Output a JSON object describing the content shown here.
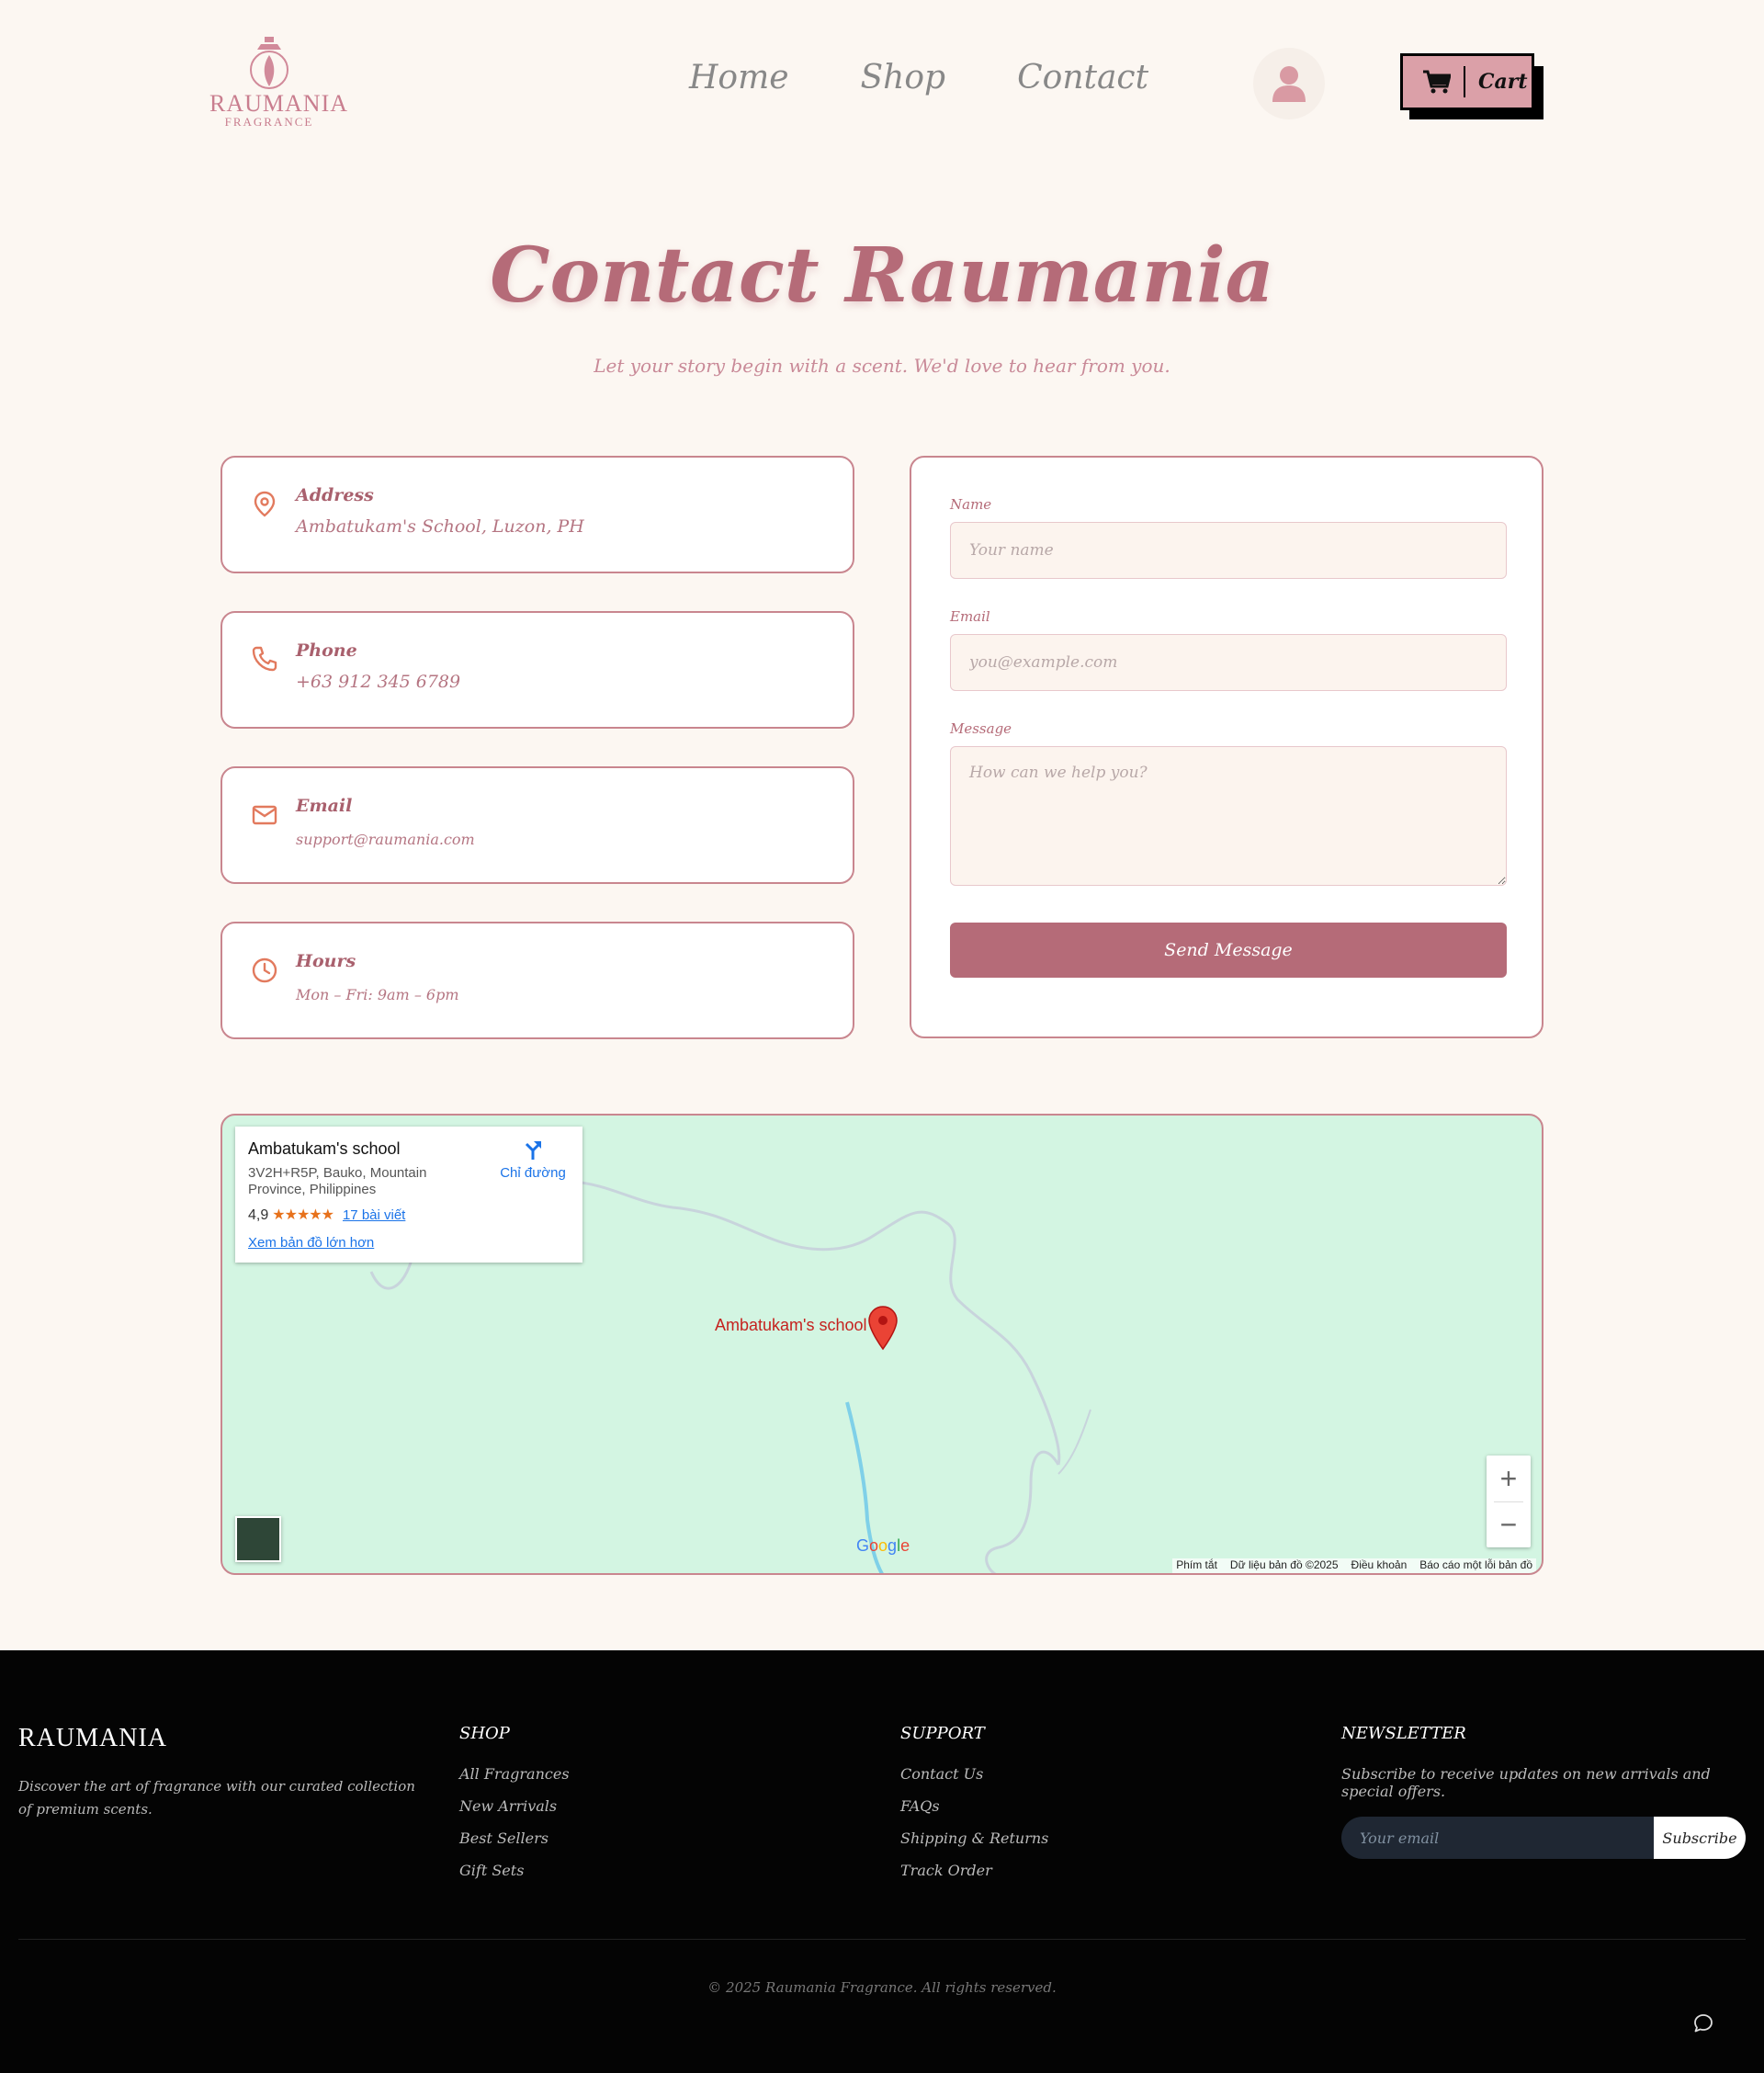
{
  "header": {
    "logo": {
      "brand": "RAUMANIA",
      "sub": "FRAGRANCE"
    },
    "nav": [
      {
        "label": "Home"
      },
      {
        "label": "Shop"
      },
      {
        "label": "Contact"
      }
    ],
    "cart_label": "Cart",
    "user_icon": "user-icon",
    "cart_icon": "cart-icon"
  },
  "hero": {
    "title": "Contact Raumania",
    "subtitle": "Let your story begin with a scent. We'd love to hear from you."
  },
  "info": [
    {
      "title": "Address",
      "value": "Ambatukam's School, Luzon, PH",
      "icon": "map-pin-icon"
    },
    {
      "title": "Phone",
      "value": "+63 912 345 6789",
      "icon": "phone-icon"
    },
    {
      "title": "Email",
      "value": "support@raumania.com",
      "icon": "mail-icon"
    },
    {
      "title": "Hours",
      "value": "Mon – Fri: 9am – 6pm",
      "icon": "clock-icon"
    }
  ],
  "form": {
    "name_label": "Name",
    "name_placeholder": "Your name",
    "email_label": "Email",
    "email_placeholder": "you@example.com",
    "message_label": "Message",
    "message_placeholder": "How can we help you?",
    "submit_label": "Send Message"
  },
  "map": {
    "place_name": "Ambatukam's school",
    "address": "3V2H+R5P, Bauko, Mountain Province, Philippines",
    "rating": "4,9",
    "stars": "★★★★★",
    "reviews": "17 bài viết",
    "directions": "Chỉ đường",
    "view_larger": "Xem bản đồ lớn hơn",
    "marker_label": "Ambatukam's school",
    "zoom_in": "+",
    "zoom_out": "−",
    "attribution": [
      "Phím tắt",
      "Dữ liệu bản đồ ©2025",
      "Điều khoản",
      "Báo cáo một lỗi bản đồ"
    ]
  },
  "footer": {
    "brand": "RAUMANIA",
    "description": "Discover the art of fragrance with our curated collection of premium scents.",
    "shop": {
      "heading": "SHOP",
      "links": [
        "All Fragrances",
        "New Arrivals",
        "Best Sellers",
        "Gift Sets"
      ]
    },
    "support": {
      "heading": "SUPPORT",
      "links": [
        "Contact Us",
        "FAQs",
        "Shipping & Returns",
        "Track Order"
      ]
    },
    "newsletter": {
      "heading": "NEWSLETTER",
      "text": "Subscribe to receive updates on new arrivals and special offers.",
      "placeholder": "Your email",
      "button": "Subscribe"
    },
    "copyright": "© 2025 Raumania Fragrance. All rights reserved.",
    "chat_icon": "chat-icon"
  },
  "colors": {
    "background": "#fcf7f2",
    "accent": "#b56b78",
    "card_border": "#c9868f",
    "cart_bg": "#dba0a8",
    "map_bg": "#d3f5e2",
    "footer_bg": "#040404"
  }
}
